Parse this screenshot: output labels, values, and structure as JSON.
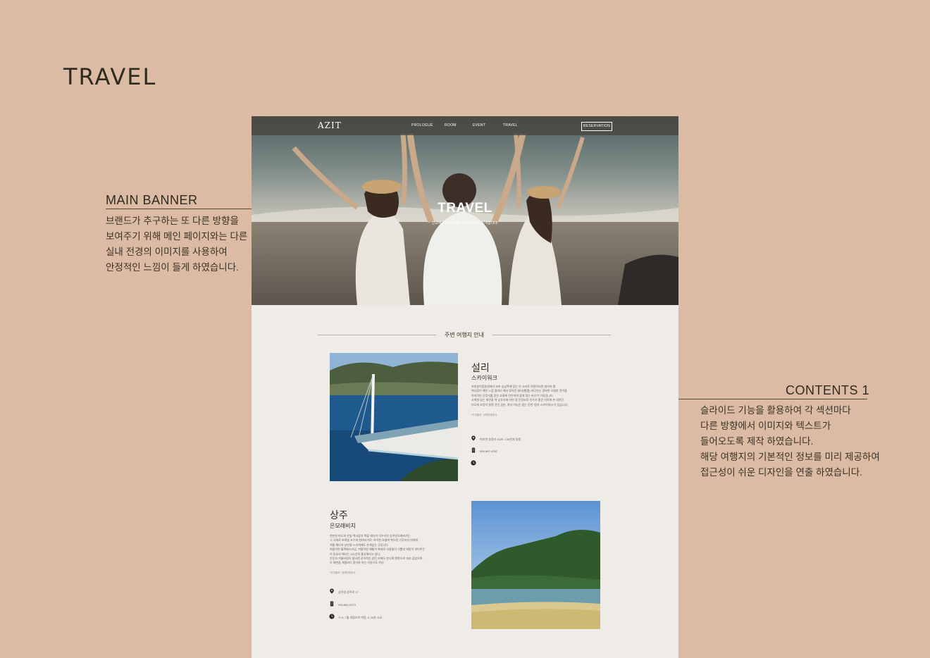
{
  "page": {
    "title": "TRAVEL"
  },
  "annotations": {
    "main_banner": {
      "heading": "MAIN BANNER",
      "lines": [
        "브랜드가 추구하는 또 다른 방향을",
        "보여주기 위해 메인 페이지와는 다른",
        "실내 전경의 이미지를 사용하여",
        "안정적인 느낌이 들게 하였습니다."
      ]
    },
    "contents": {
      "heading": "CONTENTS 1",
      "lines": [
        "슬라이드 기능을 활용하여 각 섹션마다",
        "다른 방향에서 이미지와 텍스트가",
        "들어오도록 제작 하였습니다.",
        "해당 여행지의 기본적인 정보를 미리 제공하여",
        "접근성이 쉬운 디자인을 연출 하였습니다."
      ]
    }
  },
  "mockup": {
    "nav": {
      "logo": "AZIT",
      "items": [
        "PROLOGUE",
        "ROOM",
        "EVENT",
        "TRAVEL"
      ],
      "reserve": "RESERVATION"
    },
    "hero": {
      "title": "TRAVEL",
      "subtitle": "근교에 위치한 아름다운 여행지를 소개합니다."
    },
    "section_title": "주변 여행지 안내",
    "destinations": [
      {
        "name": "설리",
        "sub": "스카이워크",
        "desc": [
          "초청송이탐험센에서 보초 높낮쪽에 있는 의 크바로 여관아되면 설이마 말.",
          "백사장이 해안 느낌 알려다 해서 찾아진 설리(雪里) 바닷가는 경보한 오밤한 맛이름",
          "아지막인 곳정치를 같은 흐름에 안안하여 출게 찾는 바닷가 이었입니다.",
          "사계절 있는 파란을 책 상유자재 하얀 경 윤정되로 안가가 흠운 어르에 손 내려간",
          "다도에 조망이 절정 것인 공만, 여자 이능은 같는 듯한 '명자 스카이워크'가 있습니다."
        ],
        "credit": "*사진출처 : 남해관광공사",
        "address": "미조면 송정리 1029 -136번지 일원",
        "phone": "055-867-4252",
        "hours": ""
      },
      {
        "name": "상주",
        "sub": "은모래비치",
        "desc": [
          "천만한 파도와 은빛 백사장과 짝할 해다가 이우러진 상주은모래비치는",
          "그 곡태로 초록빛 조수와 현대지가며, 아이한 흐름에 백스텐 기후까지 대체의",
          "겨울 해다의 낭만을 누리게해도 손색없는 곳입니다.",
          "여름이면 블랙베스지업, 겨울이면 해통이 축제로 사람들의 기쁨과 희망이 피어주는",
          "이 동요의 해다는 121년의 홍성해지고 있다.",
          "운운의 겨울바람이 빛바랜 같이적인 같던 카페도 만나며 편한으로 자리 잡았으며,",
          "이 해변을 계절마다 찾아와 하는 이유가도 하다."
        ],
        "credit": "*사진출처 : 남해관광공사",
        "address": "상주면 상주로 17",
        "phone": "055-860-3073",
        "hours": "※ 6, 7월 개장으로 여동 시 20분 소요"
      }
    ]
  }
}
